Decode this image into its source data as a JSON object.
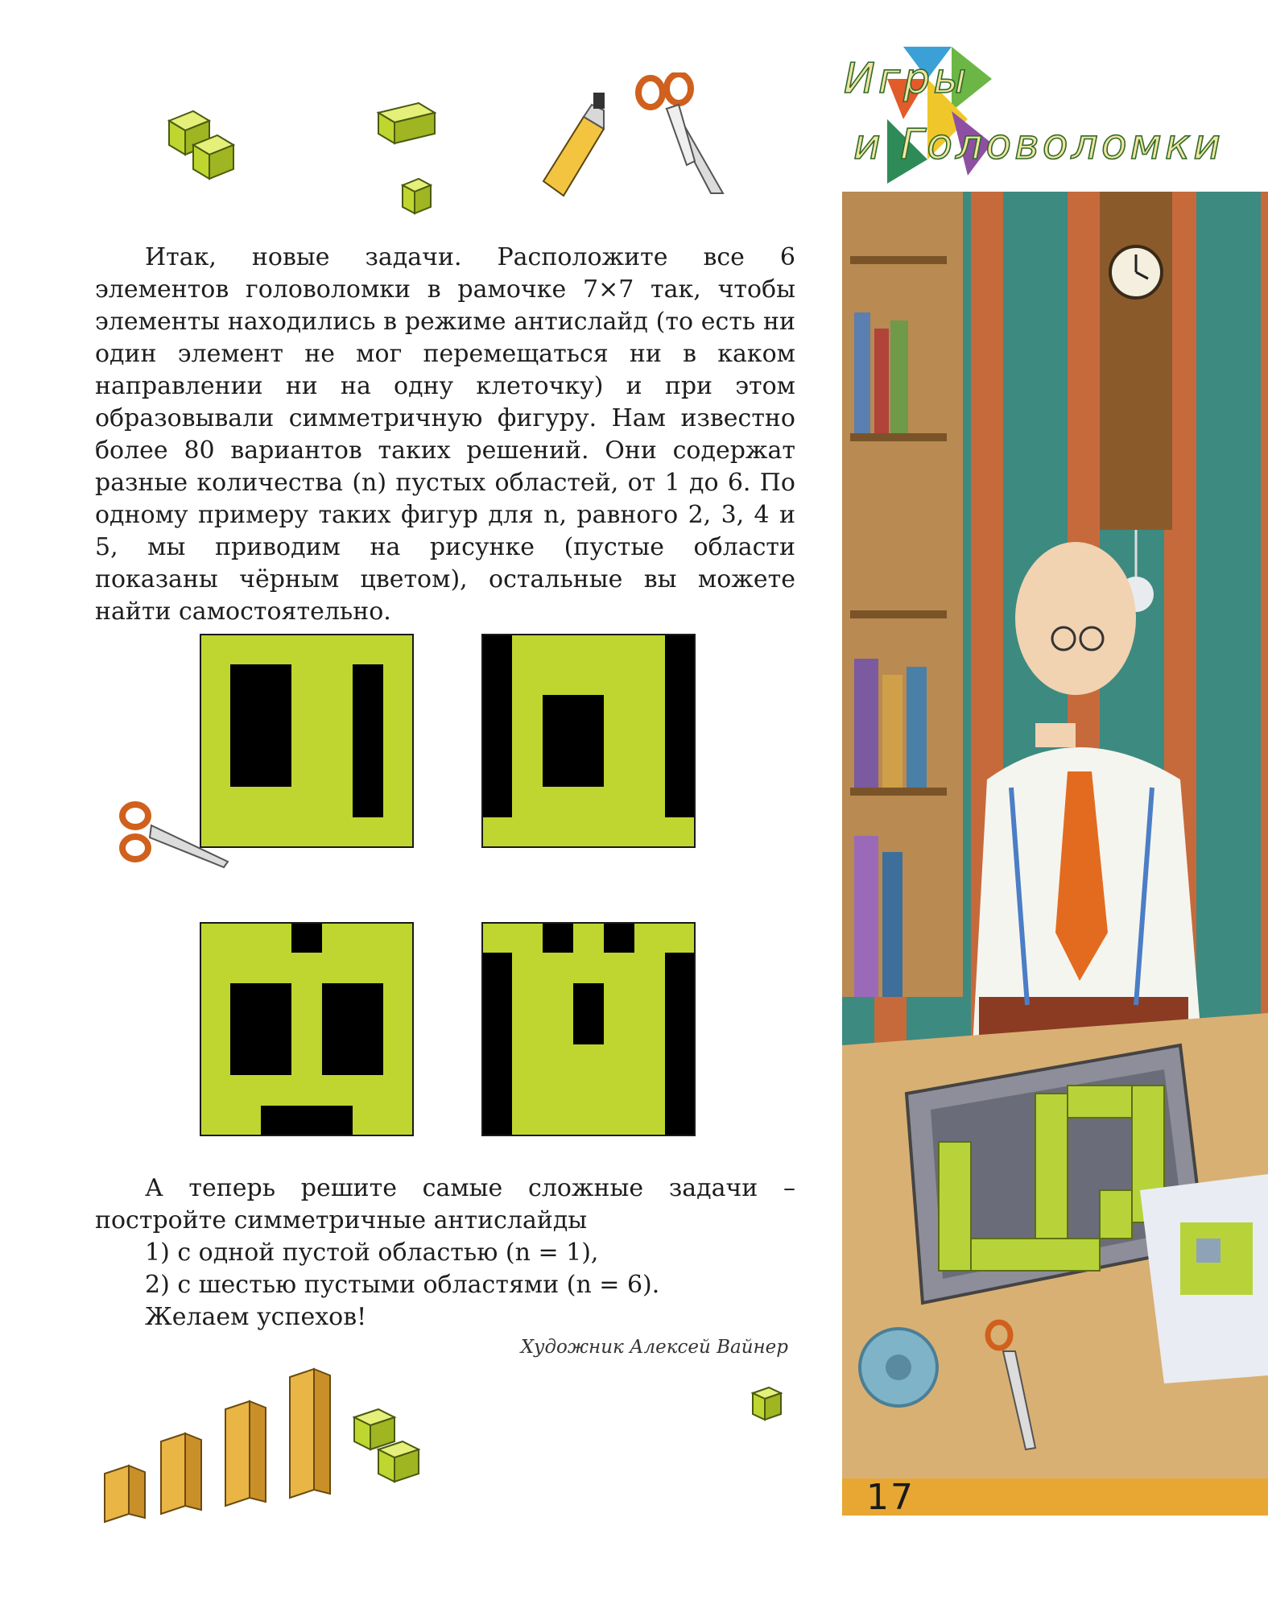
{
  "header": {
    "logo_line1": "Игры",
    "logo_line2": "и Головоломки"
  },
  "article": {
    "intro": "Итак, новые задачи. Расположите все 6 элементов головоломки в рамочке 7×7 так, чтобы элементы находились в режиме антислайд (то есть ни один элемент не мог перемещаться ни в каком направлении ни на одну клеточку) и при этом образовывали симметричную фигуру. Нам известно более 80 вариантов таких решений. Они содержат разные количества (n) пустых областей, от 1 до 6. По одному примеру таких фигур для n, равного 2, 3, 4 и 5, мы приводим на рисунке (пустые области показаны чёрным цветом), остальные вы можете найти самостоятельно.",
    "outro_line1": "А теперь решите самые сложные задачи – постройте симметричные антислайды",
    "task1": "1) с одной пустой областью (n = 1),",
    "task2": "2) с шестью пустыми областями (n = 6).",
    "wish": "Желаем успехов!",
    "credit": "Художник Алексей Вайнер"
  },
  "page_number": "17",
  "colors": {
    "piece_green": "#bed62f",
    "empty_black": "#000000",
    "grid_line": "#1a1a1a",
    "page_bar": "#e7a732",
    "stripe_teal": "#3d8a80",
    "stripe_orange": "#c66a3c"
  },
  "puzzles": [
    {
      "name": "puzzle-n2",
      "grid": [
        "GGGGGGG",
        "GBBGGBG",
        "GBBGGBG",
        "GBBGGBG",
        "GBBGGBG",
        "GGGGGBG",
        "GGGGGGG"
      ]
    },
    {
      "name": "puzzle-n3",
      "grid": [
        "BGGGGGB",
        "BGGGGGB",
        "BGBBGGB",
        "BGBBGGB",
        "BGBBGGB",
        "BGGGGGB",
        "GGGGGGG"
      ]
    },
    {
      "name": "puzzle-n4",
      "grid": [
        "GGGBGGG",
        "GGGGGGG",
        "GBBGBBG",
        "GBBGBBG",
        "GBBGBBG",
        "GGGGGGG",
        "GGBBBGG"
      ]
    },
    {
      "name": "puzzle-n5",
      "grid": [
        "GGBGBGG",
        "BGGGGGB",
        "BGGBGGB",
        "BGGBGGB",
        "BGGGGGB",
        "BGGGGGB",
        "BGGGGGB"
      ]
    }
  ]
}
